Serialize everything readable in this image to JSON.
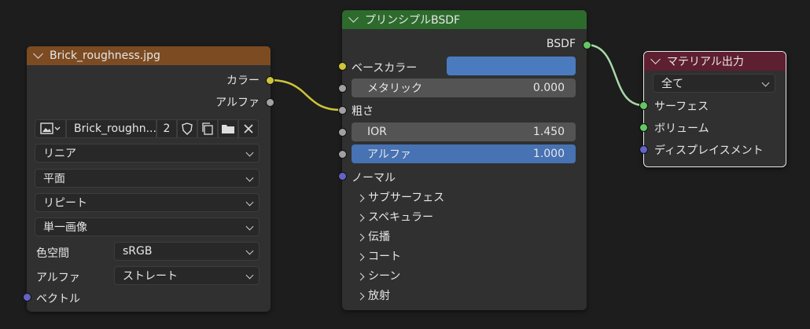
{
  "image_node": {
    "title": "Brick_roughness.jpg",
    "outputs": {
      "color": "カラー",
      "alpha": "アルファ"
    },
    "image_name": "Brick_roughn...",
    "users": "2",
    "interpolation": "リニア",
    "projection": "平面",
    "extension": "リピート",
    "source": "単一画像",
    "colorspace_label": "色空間",
    "colorspace_value": "sRGB",
    "alpha_label": "アルファ",
    "alpha_value": "ストレート",
    "vector_input": "ベクトル"
  },
  "bsdf_node": {
    "title": "プリンシプルBSDF",
    "output": "BSDF",
    "base_color": "ベースカラー",
    "base_color_swatch": "#4a7bbf",
    "metallic_label": "メタリック",
    "metallic_value": "0.000",
    "roughness": "粗さ",
    "ior_label": "IOR",
    "ior_value": "1.450",
    "alpha_label": "アルファ",
    "alpha_value": "1.000",
    "normal": "ノーマル",
    "panels": [
      "サブサーフェス",
      "スペキュラー",
      "伝播",
      "コート",
      "シーン",
      "放射"
    ]
  },
  "output_node": {
    "title": "マテリアル出力",
    "target": "全て",
    "surface": "サーフェス",
    "volume": "ボリューム",
    "displacement": "ディスプレイスメント"
  },
  "colors": {
    "image_header": "#7c4b22",
    "bsdf_header": "#2d6b2d",
    "output_header": "#5e1f30",
    "link_yellow": "#cfc43a",
    "link_grey": "#a1a1a1",
    "link_green": "#a8d8a8"
  }
}
